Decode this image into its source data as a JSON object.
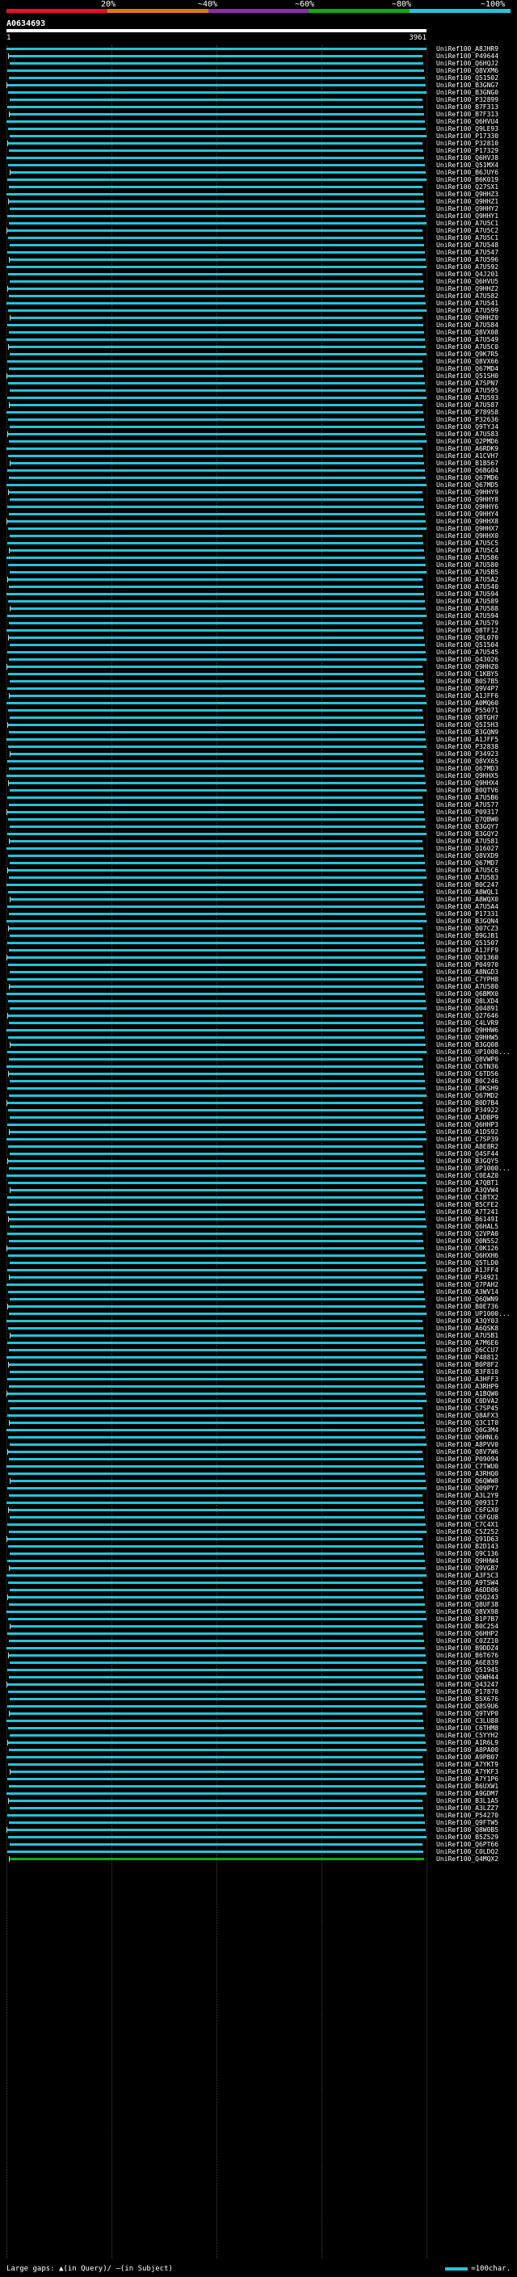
{
  "identity_legend": {
    "labels": [
      "20%",
      "~40%",
      "~60%",
      "~80%",
      "~100%"
    ],
    "colors": [
      "#e8102a",
      "#e07818",
      "#8a2fa8",
      "#10a818",
      "#22c4d8"
    ]
  },
  "query": {
    "title": "A0634693",
    "start": "1",
    "end": "3961"
  },
  "hit_color": "#22c4d8",
  "highlight_color": "#10a818",
  "hits": [
    "UniRef100_A8JHR9",
    "UniRef100_P49644",
    "UniRef100_Q6HQJ2",
    "UniRef100_Q8VXM6",
    "UniRef100_Q51502",
    "UniRef100_B3GNG7",
    "UniRef100_B3GNG0",
    "UniRef100_P32899",
    "UniRef100_B7F313",
    "UniRef100_B7F313",
    "UniRef100_Q6HVU4",
    "UniRef100_Q9LE93",
    "UniRef100_P17330",
    "UniRef100_P32810",
    "UniRef100_P17329",
    "UniRef100_Q6HVJ8",
    "UniRef100_Q51MX4",
    "UniRef100_B6JUY6",
    "UniRef100_B6K019",
    "UniRef100_Q27SX1",
    "UniRef100_Q9HHZ3",
    "UniRef100_Q9HHZ1",
    "UniRef100_Q9HHY2",
    "UniRef100_Q9HHY1",
    "UniRef100_A7U5C1",
    "UniRef100_A7U5C2",
    "UniRef100_A7U5C1",
    "UniRef100_A7U548",
    "UniRef100_A7U547",
    "UniRef100_A7U596",
    "UniRef100_A7U592",
    "UniRef100_Q4J201",
    "UniRef100_Q6HVU5",
    "UniRef100_Q9HHZ2",
    "UniRef100_A7U582",
    "UniRef100_A7U541",
    "UniRef100_A7U599",
    "UniRef100_Q9HHZ0",
    "UniRef100_A7U584",
    "UniRef100_Q8VX08",
    "UniRef100_A7U549",
    "UniRef100_A7U5C0",
    "UniRef100_Q9K7R5",
    "UniRef100_Q8VX66",
    "UniRef100_Q67MD4",
    "UniRef100_Q51SH0",
    "UniRef100_A7SPN7",
    "UniRef100_A7U595",
    "UniRef100_A7U593",
    "UniRef100_A7U587",
    "UniRef100_P78958",
    "UniRef100_P32636",
    "UniRef100_Q9TYJ4",
    "UniRef100_A7U583",
    "UniRef100_Q2PMD6",
    "UniRef100_A6RDK9",
    "UniRef100_A1CVH7",
    "UniRef100_B1B567",
    "UniRef100_Q6BG04",
    "UniRef100_Q67MD6",
    "UniRef100_Q67MD5",
    "UniRef100_Q9HHY9",
    "UniRef100_Q9HHY8",
    "UniRef100_Q9HHY6",
    "UniRef100_Q9HHY4",
    "UniRef100_Q9HHX8",
    "UniRef100_Q9HHX7",
    "UniRef100_Q9HHX0",
    "UniRef100_A7U5C5",
    "UniRef100_A7U5C4",
    "UniRef100_A7U586",
    "UniRef100_A7U580",
    "UniRef100_A7U5B5",
    "UniRef100_A7U5A2",
    "UniRef100_A7U540",
    "UniRef100_A7U594",
    "UniRef100_A7U589",
    "UniRef100_A7U588",
    "UniRef100_A7U594",
    "UniRef100_A7U579",
    "UniRef100_Q8TF12",
    "UniRef100_Q9L070",
    "UniRef100_Q51504",
    "UniRef100_A7U545",
    "UniRef100_Q43026",
    "UniRef100_Q9HHZ0",
    "UniRef100_C1KBY5",
    "UniRef100_B0S7B5",
    "UniRef100_Q9V4P7",
    "UniRef100_A1JFF6",
    "UniRef100_A0MQ60",
    "UniRef100_P55071",
    "UniRef100_Q8TGH7",
    "UniRef100_Q5I5H3",
    "UniRef100_B3GQN9",
    "UniRef100_A1JFF5",
    "UniRef100_P32838",
    "UniRef100_P34923",
    "UniRef100_Q8VX65",
    "UniRef100_Q67MD3",
    "UniRef100_Q9HHX5",
    "UniRef100_Q9HHX4",
    "UniRef100_B0QTV6",
    "UniRef100_A7U5B6",
    "UniRef100_A7U577",
    "UniRef100_P09317",
    "UniRef100_Q7QBW0",
    "UniRef100_B3GQY7",
    "UniRef100_B3GQY2",
    "UniRef100_A7U581",
    "UniRef100_Q16027",
    "UniRef100_Q8VXD9",
    "UniRef100_Q67MD7",
    "UniRef100_A7U5C6",
    "UniRef100_A7U583",
    "UniRef100_B0C247",
    "UniRef100_A8WQL1",
    "UniRef100_A8WQX0",
    "UniRef100_A7U5A4",
    "UniRef100_P17331",
    "UniRef100_B3GQN4",
    "UniRef100_Q07CZ3",
    "UniRef100_B9GJB1",
    "UniRef100_Q51507",
    "UniRef100_A1JFF9",
    "UniRef100_Q01360",
    "UniRef100_P04970",
    "UniRef100_A8NGD3",
    "UniRef100_C7YPH8",
    "UniRef100_A7U580",
    "UniRef100_Q6BMX0",
    "UniRef100_Q8LXD4",
    "UniRef100_Q04891",
    "UniRef100_Q27646",
    "UniRef100_C4LVR9",
    "UniRef100_Q9HHW6",
    "UniRef100_Q9HHW5",
    "UniRef100_B3GQ08",
    "UniRef100_UP1000...",
    "UniRef100_Q8VWP0",
    "UniRef100_C6TN36",
    "UniRef100_C6TD56",
    "UniRef100_B0C246",
    "UniRef100_C0KSH9",
    "UniRef100_Q67MD2",
    "UniRef100_B0D7B4",
    "UniRef100_P34922",
    "UniRef100_A3DBP9",
    "UniRef100_Q6HHP3",
    "UniRef100_A1D592",
    "UniRef100_C7SP39",
    "UniRef100_A8E8R2",
    "UniRef100_Q4SF44",
    "UniRef100_B3GQY5",
    "UniRef100_UP1000...",
    "UniRef100_C0EAZ0",
    "UniRef100_A7QBT1",
    "UniRef100_A3QVW4",
    "UniRef100_C1BTX2",
    "UniRef100_B5CFE2",
    "UniRef100_A7T241",
    "UniRef100_B6149I",
    "UniRef100_Q6HAL5",
    "UniRef100_Q2VPA0",
    "UniRef100_Q0N5S2",
    "UniRef100_C0K126",
    "UniRef100_Q6HXH6",
    "UniRef100_Q5TLD0",
    "UniRef100_A1JFF4",
    "UniRef100_P34921",
    "UniRef100_Q7PAH2",
    "UniRef100_A3WV14",
    "UniRef100_Q6QWN9",
    "UniRef100_B0E736",
    "UniRef100_UP1000...",
    "UniRef100_A3QY03",
    "UniRef100_A6QSK8",
    "UniRef100_A7U5B1",
    "UniRef100_A7M6E6",
    "UniRef100_Q6CCU7",
    "UniRef100_P48812",
    "UniRef100_B0P8F2",
    "UniRef100_B3F810",
    "UniRef100_A3HFF3",
    "UniRef100_A3RHP9",
    "UniRef100_A1BQW0",
    "UniRef100_C0DVA2",
    "UniRef100_C7SP45",
    "UniRef100_Q8AFX3",
    "UniRef100_Q3C1T0",
    "UniRef100_Q0G3M4",
    "UniRef100_Q6HNL6",
    "UniRef100_A8PVV0",
    "UniRef100_Q8V7W6",
    "UniRef100_P09094",
    "UniRef100_C7TWU0",
    "UniRef100_A3RHQ0",
    "UniRef100_Q6QWW8",
    "UniRef100_Q09PY7",
    "UniRef100_A3L2Y9",
    "UniRef100_Q09317",
    "UniRef100_C6FGX0",
    "UniRef100_C6FGU8",
    "UniRef100_C7C4X1",
    "UniRef100_C5Z252",
    "UniRef100_Q91D63",
    "UniRef100_B2D143",
    "UniRef100_Q9C136",
    "UniRef100_Q9HHW4",
    "UniRef100_Q9VGB7",
    "UniRef100_A3F5C3",
    "UniRef100_A9TSW4",
    "UniRef100_A6DD06",
    "UniRef100_Q5Q243",
    "UniRef100_Q8UF38",
    "UniRef100_Q8VX98",
    "UniRef100_B1P7B7",
    "UniRef100_B0C254",
    "UniRef100_Q6HHP2",
    "UniRef100_C0ZZ10",
    "UniRef100_B9DDZ4",
    "UniRef100_B6T676",
    "UniRef100_A6E839",
    "UniRef100_Q51945",
    "UniRef100_Q6WH44",
    "UniRef100_Q43247",
    "UniRef100_P17870",
    "UniRef100_B5X676",
    "UniRef100_Q8S9U6",
    "UniRef100_Q9TVP0",
    "UniRef100_C3LU88",
    "UniRef100_C6THM8",
    "UniRef100_C5YYH2",
    "UniRef100_A1R6L9",
    "UniRef100_A8PA00",
    "UniRef100_A9PB07",
    "UniRef100_A7YKT9",
    "UniRef100_A7YKF3",
    "UniRef100_A7Y1P6",
    "UniRef100_B6UXW1",
    "UniRef100_A9GDM7",
    "UniRef100_B3L1A5",
    "UniRef100_A3LZZ7",
    "UniRef100_P54270",
    "UniRef100_Q9FTW5",
    "UniRef100_Q8W0B5",
    "UniRef100_B5Z529",
    "UniRef100_Q6PT66",
    "UniRef100_C0LDQ2",
    "UniRef100_Q4MQX2"
  ],
  "footer": {
    "large_gaps_label": "Large gaps:",
    "in_query_label": "(in Query)",
    "in_subject_label": "(in Subject)",
    "scale_label": "=100char."
  }
}
